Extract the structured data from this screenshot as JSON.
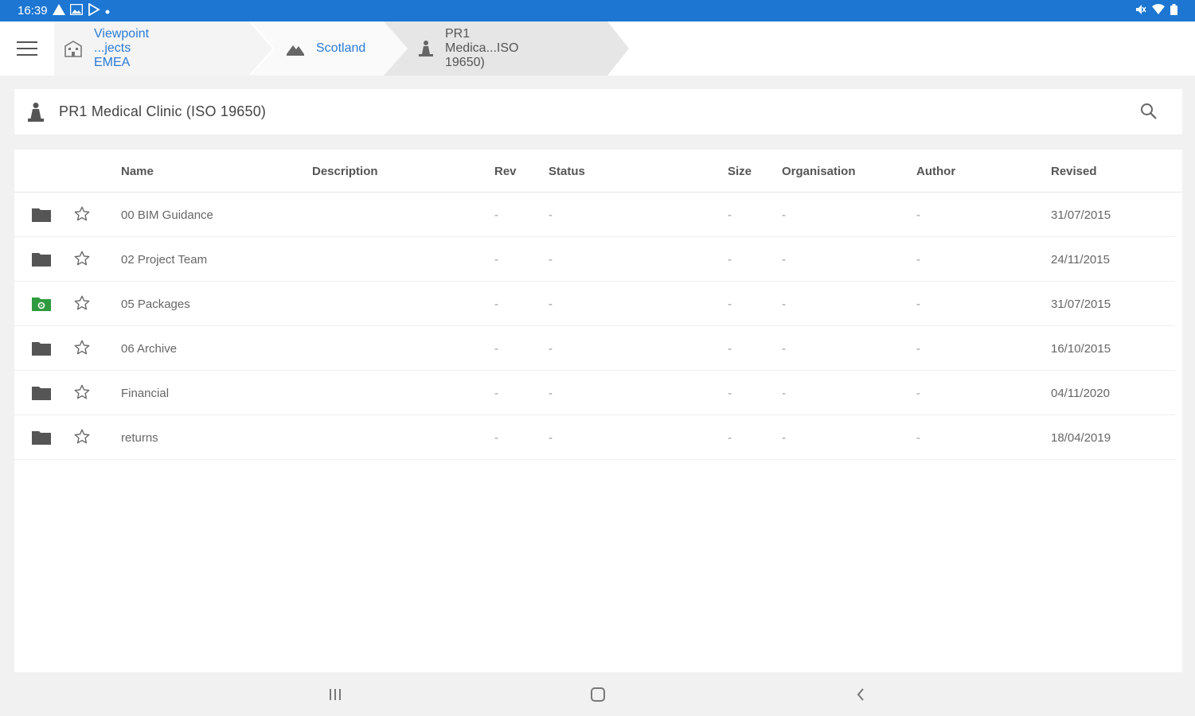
{
  "status_bar": {
    "time": "16:39"
  },
  "breadcrumbs": [
    {
      "label": "Viewpoint ...jects EMEA"
    },
    {
      "label": "Scotland"
    },
    {
      "label": "PR1 Medica...ISO 19650)"
    }
  ],
  "header": {
    "title": "PR1 Medical Clinic (ISO 19650)"
  },
  "table": {
    "columns": [
      "Name",
      "Description",
      "Rev",
      "Status",
      "Size",
      "Organisation",
      "Author",
      "Revised"
    ],
    "rows": [
      {
        "name": "00 BIM Guidance",
        "rev": "-",
        "status": "-",
        "size": "-",
        "organisation": "-",
        "author": "-",
        "revised": "31/07/2015",
        "folder_color": "#555555"
      },
      {
        "name": "02 Project Team",
        "rev": "-",
        "status": "-",
        "size": "-",
        "organisation": "-",
        "author": "-",
        "revised": "24/11/2015",
        "folder_color": "#555555"
      },
      {
        "name": "05 Packages",
        "rev": "-",
        "status": "-",
        "size": "-",
        "organisation": "-",
        "author": "-",
        "revised": "31/07/2015",
        "folder_color": "#2e9b3e"
      },
      {
        "name": "06 Archive",
        "rev": "-",
        "status": "-",
        "size": "-",
        "organisation": "-",
        "author": "-",
        "revised": "16/10/2015",
        "folder_color": "#555555"
      },
      {
        "name": "Financial",
        "rev": "-",
        "status": "-",
        "size": "-",
        "organisation": "-",
        "author": "-",
        "revised": "04/11/2020",
        "folder_color": "#555555"
      },
      {
        "name": "returns",
        "rev": "-",
        "status": "-",
        "size": "-",
        "organisation": "-",
        "author": "-",
        "revised": "18/04/2019",
        "folder_color": "#555555"
      }
    ]
  },
  "colors": {
    "status_bar": "#1c76d2",
    "link": "#2a7bd6",
    "shared_folder": "#2e9b3e"
  }
}
